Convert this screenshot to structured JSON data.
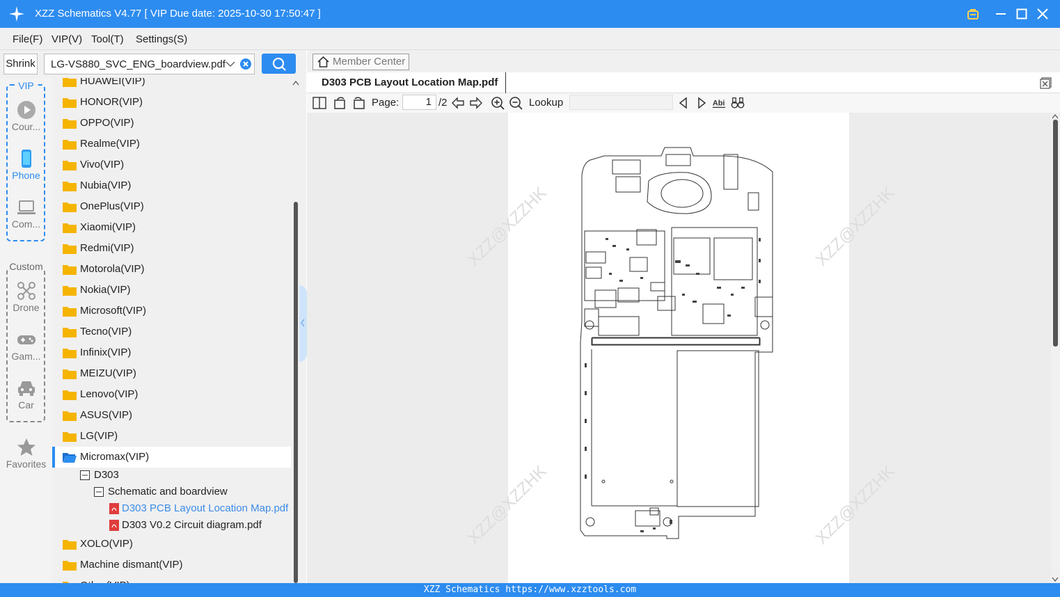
{
  "app": {
    "title": "XZZ Schematics V4.77 [ VIP Due date: 2025-10-30 17:50:47 ]"
  },
  "menu": [
    "File(F)",
    "VIP(V)",
    "Tool(T)",
    "Settings(S)"
  ],
  "left_toolbar": {
    "shrink_label": "Shrink",
    "file_value": "LG-VS880_SVC_ENG_boardview.pdf"
  },
  "sidebar": {
    "vip_title": "VIP",
    "custom_title": "Custom",
    "items": [
      {
        "label": "Cour...",
        "icon": "play-icon"
      },
      {
        "label": "Phone",
        "icon": "phone-icon"
      },
      {
        "label": "Com...",
        "icon": "laptop-icon"
      },
      {
        "label": "Drone",
        "icon": "drone-icon"
      },
      {
        "label": "Gam...",
        "icon": "gamepad-icon"
      },
      {
        "label": "Car",
        "icon": "car-icon"
      },
      {
        "label": "Favorites",
        "icon": "star-icon"
      }
    ]
  },
  "tree": [
    "HUAWEI(VIP)",
    "HONOR(VIP)",
    "OPPO(VIP)",
    "Realme(VIP)",
    "Vivo(VIP)",
    "Nubia(VIP)",
    "OnePlus(VIP)",
    "Xiaomi(VIP)",
    "Redmi(VIP)",
    "Motorola(VIP)",
    "Nokia(VIP)",
    "Microsoft(VIP)",
    "Tecno(VIP)",
    "Infinix(VIP)",
    "MEIZU(VIP)",
    "Lenovo(VIP)",
    "ASUS(VIP)",
    "LG(VIP)",
    "Micromax(VIP)"
  ],
  "tree_expanded": {
    "model": "D303",
    "category": "Schematic and boardview",
    "files": [
      "D303 PCB Layout Location Map.pdf",
      "D303 V0.2 Circuit diagram.pdf"
    ]
  },
  "tree_after": [
    "XOLO(VIP)",
    "Machine dismant(VIP)",
    "Other(VIP)"
  ],
  "right": {
    "member_center": "Member Center",
    "doc_tab": "D303 PCB Layout Location Map.pdf",
    "page_label": "Page:",
    "page_value": "1",
    "page_total": "/2",
    "lookup_label": "Lookup"
  },
  "watermark": "XZZ@XZZHK",
  "status": "XZZ Schematics https://www.xzztools.com",
  "colors": {
    "accent": "#2d8cf0",
    "folder": "#f5b400",
    "pdf": "#e03c3c",
    "link": "#3c8ce7"
  }
}
